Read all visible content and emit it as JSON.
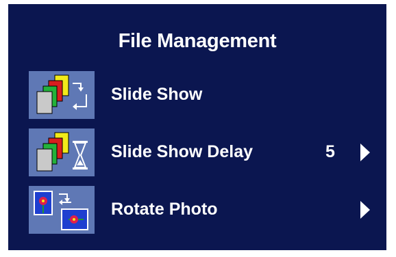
{
  "menu": {
    "title": "File Management",
    "items": [
      {
        "label": "Slide Show",
        "icon": "slideshow-icon",
        "value": "",
        "has_arrow": false
      },
      {
        "label": "Slide Show Delay",
        "icon": "slideshow-delay-hourglass-icon",
        "value": "5",
        "has_arrow": true
      },
      {
        "label": "Rotate Photo",
        "icon": "rotate-photo-icon",
        "value": "",
        "has_arrow": true
      }
    ]
  },
  "colors": {
    "background": "#0b1650",
    "icon_box": "#5f78b5",
    "text": "#ffffff"
  }
}
